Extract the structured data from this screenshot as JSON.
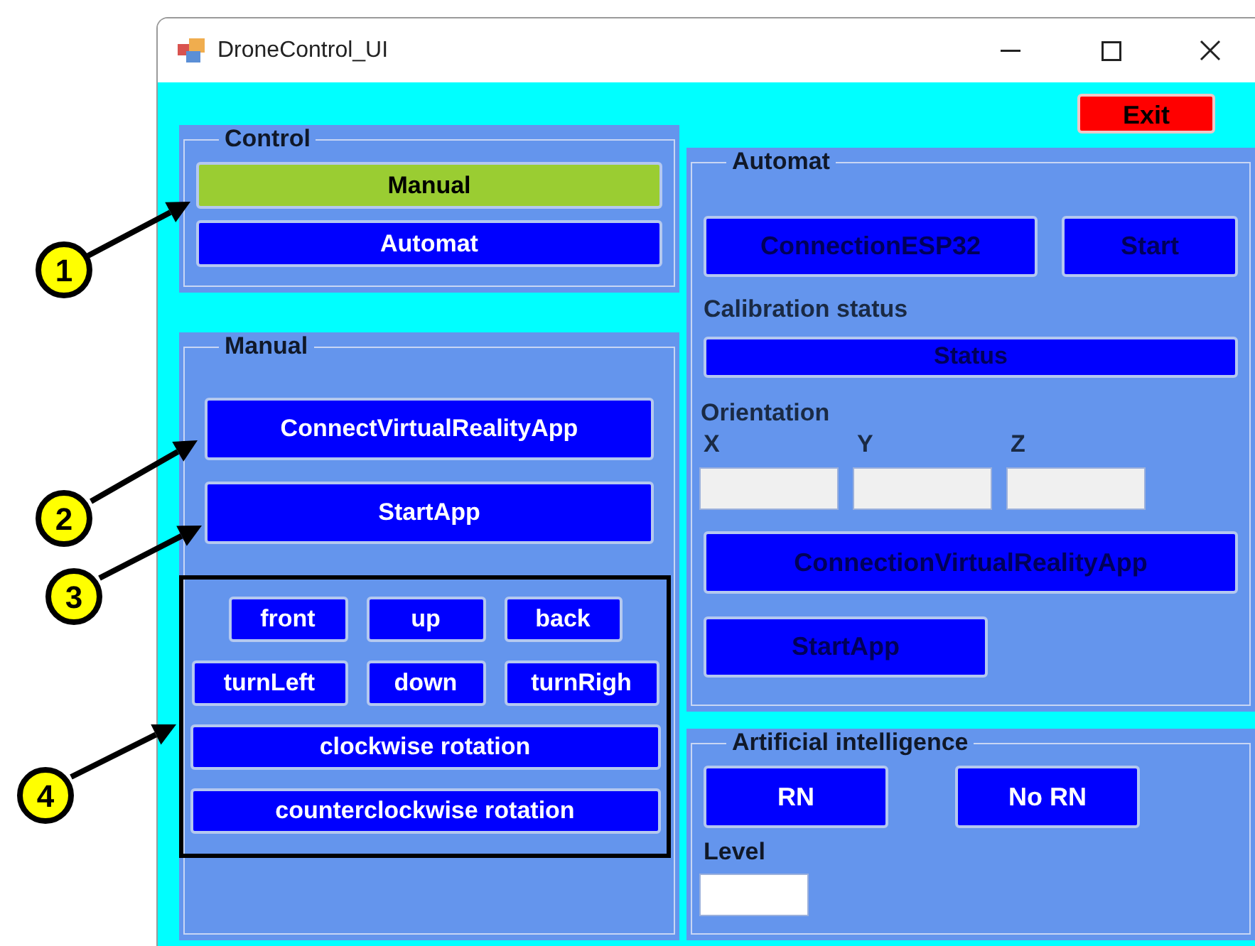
{
  "window": {
    "title": "DroneControl_UI"
  },
  "exit_button": {
    "label": "Exit"
  },
  "control": {
    "title": "Control",
    "modes": [
      {
        "label": "Manual",
        "selected": true
      },
      {
        "label": "Automat",
        "selected": false
      }
    ]
  },
  "manual": {
    "title": "Manual",
    "buttons": [
      {
        "label": "ConnectVirtualRealityApp",
        "disabled": false
      },
      {
        "label": "StartApp",
        "disabled": false
      }
    ],
    "movement": [
      [
        "front",
        "up",
        "back"
      ],
      [
        "turnLeft",
        "down",
        "turnRigh"
      ],
      [
        "clockwise rotation"
      ],
      [
        "counterclockwise rotation"
      ]
    ]
  },
  "automat": {
    "title": "Automat",
    "connect": {
      "label": "ConnectionESP32",
      "disabled": true
    },
    "start": {
      "label": "Start",
      "disabled": true
    },
    "calibration_label": "Calibration status",
    "status": {
      "label": "Status",
      "disabled": true
    },
    "orientation_label": "Orientation",
    "axes": [
      "X",
      "Y",
      "Z"
    ],
    "vr_button": {
      "label": "ConnectionVirtualRealityApp",
      "disabled": true
    },
    "start_app": {
      "label": "StartApp",
      "disabled": true
    }
  },
  "ai": {
    "title": "Artificial intelligence",
    "buttons": [
      {
        "label": "RN",
        "disabled": false
      },
      {
        "label": "No RN",
        "disabled": false
      }
    ],
    "level_label": "Level"
  },
  "callouts": [
    "1",
    "2",
    "3",
    "4"
  ]
}
